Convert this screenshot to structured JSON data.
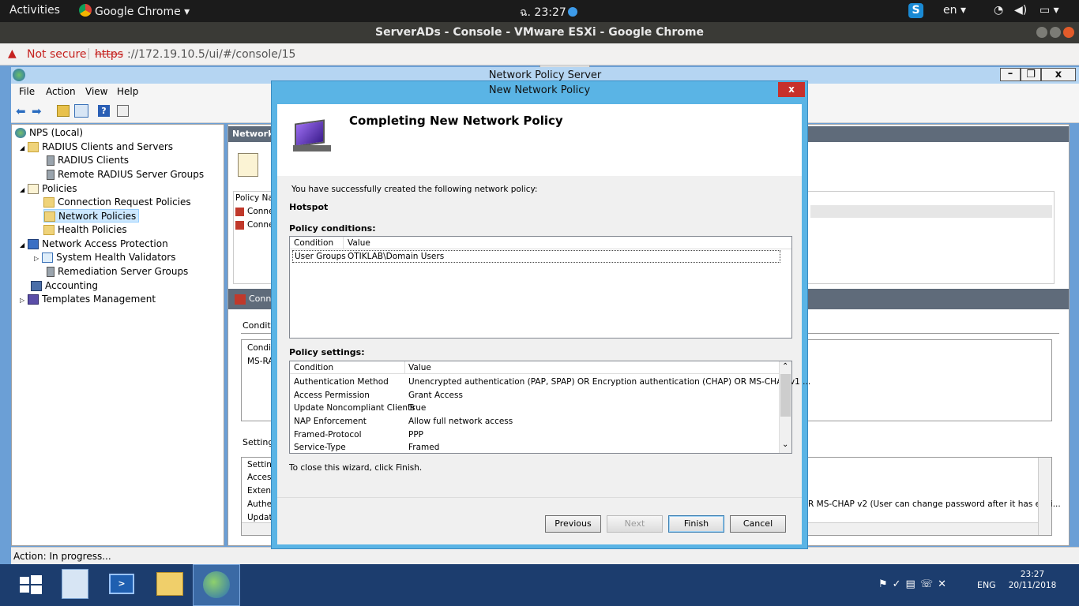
{
  "gnome": {
    "activities": "Activities",
    "app_name": "Google Chrome",
    "clock": "ฉ. 23:27",
    "lang": "en"
  },
  "chrome": {
    "window_title": "ServerADs - Console - VMware ESXi - Google Chrome",
    "not_secure": "Not secure",
    "url_scheme": "https",
    "url_rest": "://172.19.10.5/ui/#/console/15"
  },
  "nps": {
    "title": "Network Policy Server",
    "menu": [
      "File",
      "Action",
      "View",
      "Help"
    ],
    "tree": [
      {
        "label": "NPS (Local)"
      },
      {
        "label": "RADIUS Clients and Servers"
      },
      {
        "label": "RADIUS Clients"
      },
      {
        "label": "Remote RADIUS Server Groups"
      },
      {
        "label": "Policies"
      },
      {
        "label": "Connection Request Policies"
      },
      {
        "label": "Network Policies"
      },
      {
        "label": "Health Policies"
      },
      {
        "label": "Network Access Protection"
      },
      {
        "label": "System Health Validators"
      },
      {
        "label": "Remediation Server Groups"
      },
      {
        "label": "Accounting"
      },
      {
        "label": "Templates Management"
      }
    ],
    "right": {
      "header": "Network",
      "policy_col": "Policy Nar",
      "rows": [
        "Conne",
        "Conne"
      ],
      "section2": "Conn",
      "conditions_label": "Conditio",
      "cond_col": "Condit",
      "cond_row": "MS-RA",
      "settings_label": "Settings",
      "settings_rows": [
        "Setting",
        "Access",
        "Extens",
        "Authen",
        "Update"
      ],
      "truncated_setting": "R MS-CHAP v2 (User can change password after it has expi..."
    },
    "status": "Action:  In progress..."
  },
  "dialog": {
    "title": "New Network Policy",
    "heading": "Completing New Network Policy",
    "intro": "You have successfully created the following network policy:",
    "policy_name": "Hotspot",
    "conditions_label": "Policy conditions:",
    "conditions_headers": [
      "Condition",
      "Value"
    ],
    "conditions": [
      {
        "condition": "User Groups",
        "value": "OTIKLAB\\Domain Users"
      }
    ],
    "settings_label": "Policy settings:",
    "settings_headers": [
      "Condition",
      "Value"
    ],
    "settings": [
      {
        "condition": "Authentication Method",
        "value": "Unencrypted authentication (PAP, SPAP) OR Encryption authentication (CHAP) OR MS-CHAP v1 ..."
      },
      {
        "condition": "Access Permission",
        "value": "Grant Access"
      },
      {
        "condition": "Update Noncompliant Clients",
        "value": "True"
      },
      {
        "condition": "NAP Enforcement",
        "value": "Allow full network access"
      },
      {
        "condition": "Framed-Protocol",
        "value": "PPP"
      },
      {
        "condition": "Service-Type",
        "value": "Framed"
      }
    ],
    "close_hint": "To close this wizard, click Finish.",
    "buttons": {
      "previous": "Previous",
      "next": "Next",
      "finish": "Finish",
      "cancel": "Cancel"
    }
  },
  "taskbar": {
    "lang": "ENG",
    "time": "23:27",
    "date": "20/11/2018"
  },
  "colors": {
    "dialog_border": "#5ab4e5",
    "taskbar": "#1c3d6e",
    "not_secure": "#c5221f"
  }
}
